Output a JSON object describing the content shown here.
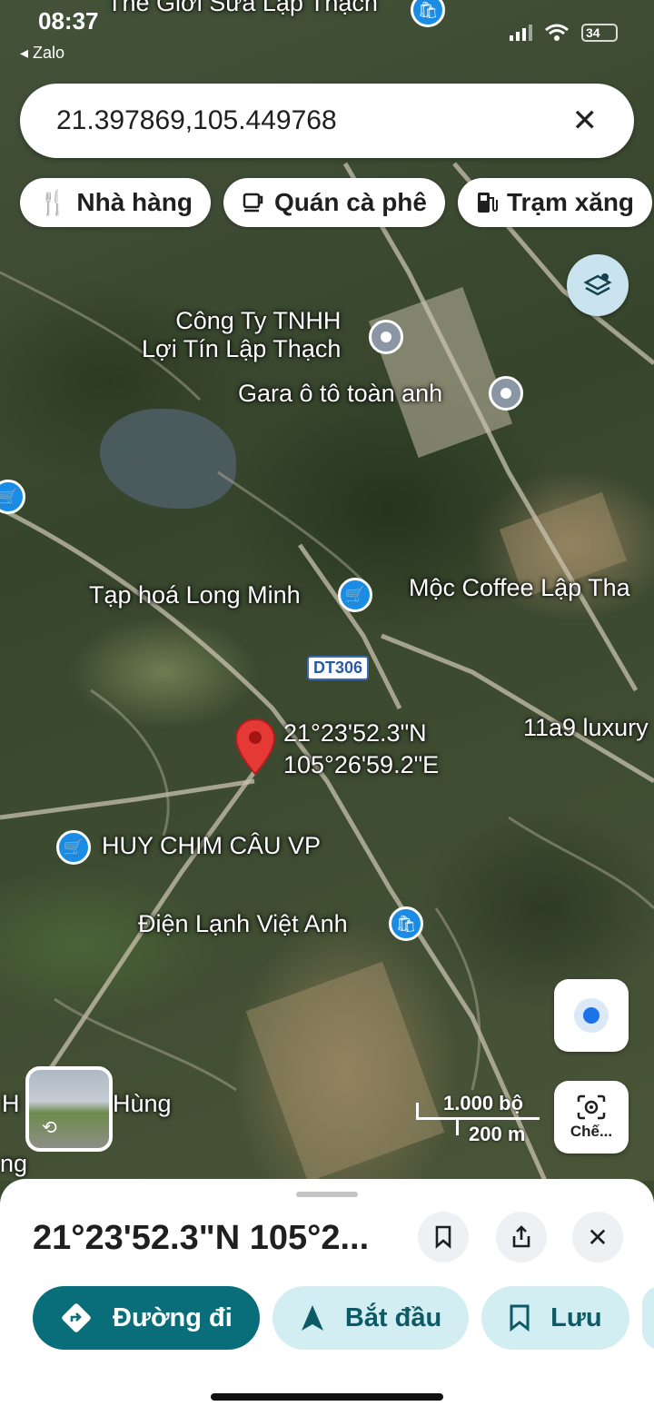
{
  "status_bar": {
    "time": "08:37",
    "back_app": "Zalo",
    "battery": "34"
  },
  "search": {
    "value": "21.397869,105.449768",
    "close_icon": "✕"
  },
  "chips": [
    {
      "icon": "restaurant-icon",
      "label": "Nhà hàng"
    },
    {
      "icon": "coffee-icon",
      "label": "Quán cà phê"
    },
    {
      "icon": "gas-station-icon",
      "label": "Trạm xăng"
    }
  ],
  "map": {
    "labels": {
      "top_shop": "Thế Giới Sữa Lập Thạch",
      "company": "Công Ty TNHH\nLợi Tín Lập Thạch",
      "garage": "Gara ô tô toàn anh",
      "grocery": "Tạp hoá Long Minh",
      "coffee": "Mộc Coffee Lập Tha",
      "luxury": "11a9 luxury",
      "pigeon": "HUY CHIM CÂU VP",
      "electric": "Điện Lạnh Việt Anh",
      "hung": "Hùng",
      "left_h": "H",
      "left_ng": "ng"
    },
    "road_shield": "DT306",
    "pin_coords": {
      "lat": "21°23'52.3\"N",
      "lng": "105°26'59.2\"E"
    },
    "scale": {
      "feet": "1.000 bộ",
      "meters": "200 m"
    },
    "lens_label": "Chế..."
  },
  "sheet": {
    "title": "21°23'52.3\"N 105°2...",
    "actions": {
      "directions": "Đường đi",
      "start": "Bắt đầu",
      "save": "Lưu"
    }
  },
  "colors": {
    "primary": "#0a6e7a",
    "secondary_bg": "#d3eef3",
    "pin": "#e53935"
  }
}
